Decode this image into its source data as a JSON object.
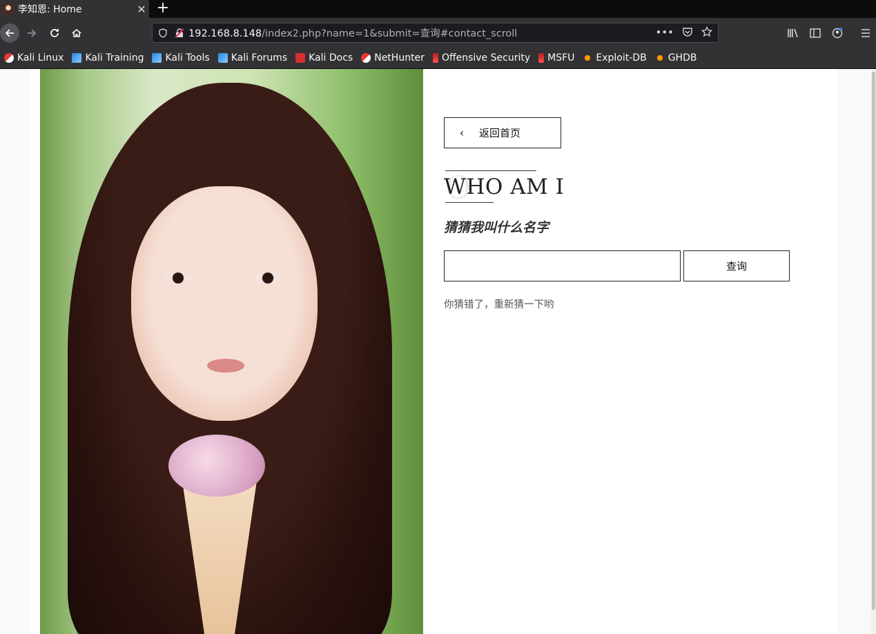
{
  "browser": {
    "tab": {
      "title": "李知恩: Home",
      "close_glyph": "✕"
    },
    "new_tab_glyph": "+",
    "url": {
      "host": "192.168.8.148",
      "path": "/index2.php?name=1&submit=查询#contact_scroll"
    },
    "bookmarks": [
      {
        "label": "Kali Linux",
        "icon": "kali-icon"
      },
      {
        "label": "Kali Training",
        "icon": "kali-training-icon"
      },
      {
        "label": "Kali Tools",
        "icon": "kali-tools-icon"
      },
      {
        "label": "Kali Forums",
        "icon": "kali-forums-icon"
      },
      {
        "label": "Kali Docs",
        "icon": "kali-docs-icon"
      },
      {
        "label": "NetHunter",
        "icon": "nethunter-icon"
      },
      {
        "label": "Offensive Security",
        "icon": "offsec-icon"
      },
      {
        "label": "MSFU",
        "icon": "msfu-icon"
      },
      {
        "label": "Exploit-DB",
        "icon": "exploitdb-icon"
      },
      {
        "label": "GHDB",
        "icon": "ghdb-icon"
      }
    ]
  },
  "page": {
    "back_button": {
      "chevron": "‹",
      "label": "返回首页"
    },
    "ghost_letter": "O",
    "heading": "WHO AM I",
    "subtitle": "猜猜我叫什么名字",
    "name_input": {
      "value": "",
      "placeholder": ""
    },
    "submit_label": "查询",
    "result_text": "你猜错了，重新猜一下哟"
  }
}
